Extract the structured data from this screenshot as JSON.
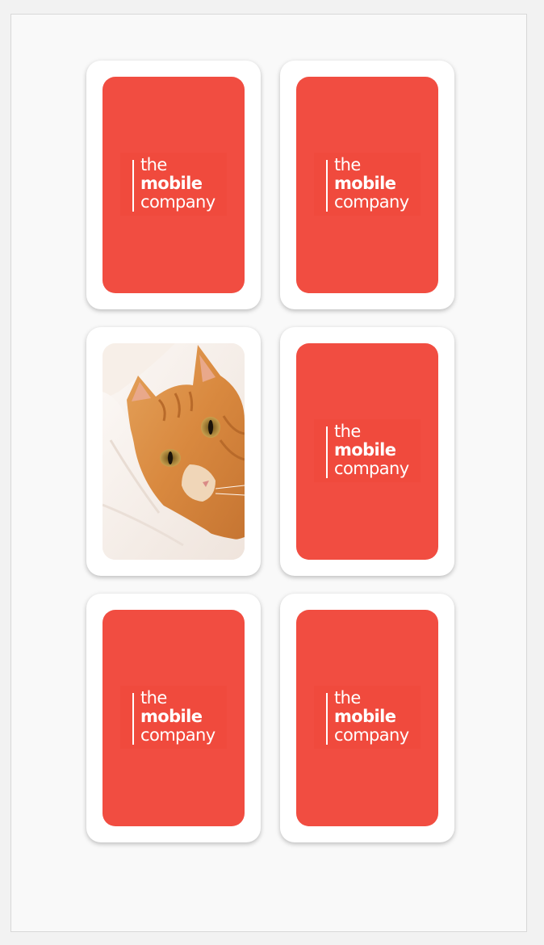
{
  "colors": {
    "card_back": "#f14d41",
    "card_frame": "#ffffff",
    "cat_fur": "#d9893f"
  },
  "logo": {
    "line1": "the",
    "line2": "mobile",
    "line3": "company"
  },
  "cards": [
    {
      "state": "face-down"
    },
    {
      "state": "face-down"
    },
    {
      "state": "face-up",
      "image": "ginger-cat-photo"
    },
    {
      "state": "face-down"
    },
    {
      "state": "face-down"
    },
    {
      "state": "face-down"
    }
  ]
}
